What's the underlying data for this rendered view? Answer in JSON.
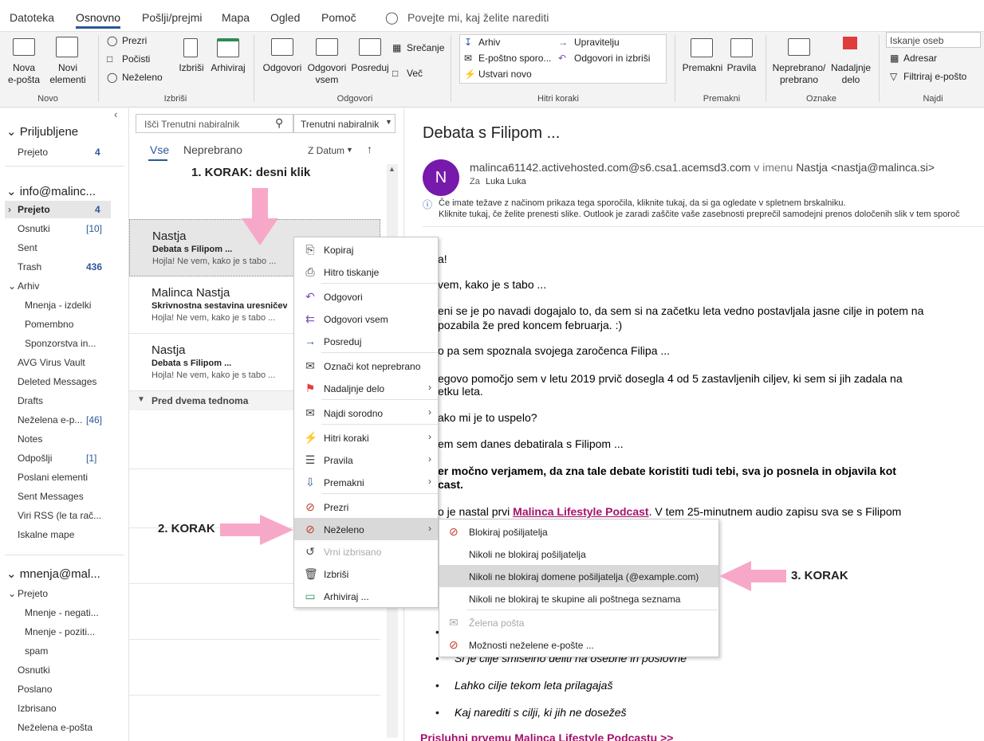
{
  "menubar": {
    "tabs": [
      "Datoteka",
      "Osnovno",
      "Pošlji/prejmi",
      "Mapa",
      "Ogled",
      "Pomoč"
    ],
    "tell_me": "Povejte mi, kaj želite narediti"
  },
  "ribbon": {
    "new_email": "Nova\ne-pošta",
    "new_items": "Novi\nelementi",
    "ignore": "Prezri",
    "cleanup": "Počisti",
    "junk": "Neželeno",
    "delete": "Izbriši",
    "archive": "Arhiviraj",
    "reply": "Odgovori",
    "reply_all": "Odgovori\nvsem",
    "forward": "Posreduj",
    "meeting": "Srečanje",
    "more": "Več",
    "qs_archive": "Arhiv",
    "qs_manager": "Upravitelju",
    "qs_email": "E-poštno sporo...",
    "qs_reply_delete": "Odgovori in izbriši",
    "qs_create": "Ustvari novo",
    "move": "Premakni",
    "rules": "Pravila",
    "unread": "Neprebrano/\nprebrano",
    "followup": "Nadaljnje\ndelo",
    "search_people": "Iskanje oseb",
    "address_book": "Adresar",
    "filter": "Filtriraj e-pošto",
    "groups": [
      "Novo",
      "Izbriši",
      "Odgovori",
      "Hitri koraki",
      "Premakni",
      "Oznake",
      "Najdi"
    ]
  },
  "nav": {
    "favorites": "Priljubljene",
    "fav_inbox": "Prejeto",
    "fav_inbox_count": "4",
    "account1": "info@malinc...",
    "items1": [
      {
        "label": "Prejeto",
        "count": "4"
      },
      {
        "label": "Osnutki",
        "count": "[10]"
      },
      {
        "label": "Sent",
        "count": ""
      },
      {
        "label": "Trash",
        "count": "436"
      },
      {
        "label": "Arhiv",
        "count": ""
      },
      {
        "label": "Mnenja  - izdelki",
        "count": ""
      },
      {
        "label": "Pomembno",
        "count": ""
      },
      {
        "label": "Sponzorstva in...",
        "count": ""
      },
      {
        "label": "AVG Virus Vault",
        "count": ""
      },
      {
        "label": "Deleted Messages",
        "count": ""
      },
      {
        "label": "Drafts",
        "count": ""
      },
      {
        "label": "Neželena e-p...",
        "count": "[46]"
      },
      {
        "label": "Notes",
        "count": ""
      },
      {
        "label": "Odpošlji",
        "count": "[1]"
      },
      {
        "label": "Poslani elementi",
        "count": ""
      },
      {
        "label": "Sent Messages",
        "count": ""
      },
      {
        "label": "Viri RSS (le ta rač...",
        "count": ""
      },
      {
        "label": "Iskalne mape",
        "count": ""
      }
    ],
    "account2": "mnenja@mal...",
    "items2": [
      "Prejeto",
      "Mnenje - negati...",
      "Mnenje - poziti...",
      "spam",
      "Osnutki",
      "Poslano",
      "Izbrisano",
      "Neželena e-pošta"
    ]
  },
  "list": {
    "search_placeholder": "Išči Trenutni nabiralnik",
    "scope": "Trenutni nabiralnik",
    "tab_all": "Vse",
    "tab_unread": "Neprebrano",
    "sort": "Z Datum",
    "group": "Pred dvema tednoma",
    "items": [
      {
        "sender": "Nastja",
        "subject": "Debata s Filipom ...",
        "preview": "Hojla!  Ne vem, kako je s tabo ..."
      },
      {
        "sender": "Malinca Nastja",
        "subject": "Skrivnostna sestavina uresničevanj...",
        "preview": "Hojla!  Ne vem, kako je s tabo ..."
      },
      {
        "sender": "Nastja",
        "subject": "Debata s Filipom ...",
        "preview": "Hojla!  Ne vem, kako je s tabo ..."
      }
    ]
  },
  "read": {
    "title": "Debata s Filipom ...",
    "avatar": "N",
    "from": "malinca61142.activehosted.com@s6.csa1.acemsd3.com",
    "on_behalf": "v imenu",
    "from_name": "Nastja <nastja@malinca.si>",
    "to_label": "Za",
    "to": "Luka Luka",
    "info1": "Če imate težave z načinom prikaza tega sporočila, kliknite tukaj, da si ga ogledate v spletnem brskalniku.",
    "info2": "Kliknite tukaj, če želite prenesti slike. Outlook je zaradi zaščite vaše zasebnosti preprečil samodejni prenos določenih slik v tem sporoč",
    "body": [
      "a!",
      "vem, kako je s tabo ...",
      "eni se je po navadi dogajalo to, da sem si na začetku leta vedno postavljala jasne cilje in potem na",
      "pozabila že pred koncem februarja. :)",
      "o pa sem spoznala svojega zaročenca Filipa ...",
      "egovo pomočjo sem v letu 2019 prvič dosegla 4 od 5 zastavljenih ciljev, ki sem si jih zadala na",
      "etku leta.",
      "ako mi je to uspelo?",
      "em sem danes debatirala s Filipom ...",
      "er močno verjamem, da zna tale debate koristiti tudi tebi, sva jo posnela in objavila kot",
      "cast.",
      "o je nastal prvi ",
      "Malinca Lifestyle Podcast",
      ". V tem 25-minutnem audio zapisu sva se s Filipom"
    ],
    "bullets": [
      "Si je cilje smiselno deliti na osebne in poslovne",
      "Lahko cilje tekom leta prilagajaš",
      "Kaj narediti s cilji, ki jih ne dosežeš"
    ],
    "link_bottom": "Prisluhni prvemu Malinca Lifestyle Podcastu >>"
  },
  "context": [
    {
      "label": "Kopiraj",
      "icon": "copy-icon"
    },
    {
      "label": "Hitro tiskanje",
      "icon": "print-icon"
    },
    {
      "label": "Odgovori",
      "icon": "reply-icon"
    },
    {
      "label": "Odgovori vsem",
      "icon": "reply-all-icon"
    },
    {
      "label": "Posreduj",
      "icon": "forward-icon"
    },
    {
      "label": "Označi kot neprebrano",
      "icon": "envelope-icon"
    },
    {
      "label": "Nadaljnje delo",
      "icon": "flag-icon"
    },
    {
      "label": "Najdi sorodno",
      "icon": "find-icon"
    },
    {
      "label": "Hitri koraki",
      "icon": "bolt-icon"
    },
    {
      "label": "Pravila",
      "icon": "rules-icon"
    },
    {
      "label": "Premakni",
      "icon": "move-icon"
    },
    {
      "label": "Prezri",
      "icon": "ignore-icon"
    },
    {
      "label": "Neželeno",
      "icon": "junk-icon"
    },
    {
      "label": "Vrni izbrisano",
      "icon": "restore-icon"
    },
    {
      "label": "Izbriši",
      "icon": "trash-icon"
    },
    {
      "label": "Arhiviraj ...",
      "icon": "archive-icon"
    }
  ],
  "submenu": [
    "Blokiraj pošiljatelja",
    "Nikoli ne blokiraj pošiljatelja",
    "Nikoli ne blokiraj domene pošiljatelja (@example.com)",
    "Nikoli ne blokiraj te skupine ali poštnega seznama",
    "Želena pošta",
    "Možnosti neželene e-pošte ..."
  ],
  "steps": {
    "s1": "1. KORAK: desni klik",
    "s2": "2. KORAK",
    "s3": "3. KORAK"
  },
  "colors": {
    "accent": "#2b579a",
    "avatar": "#7719aa",
    "arrow": "#f7a8c8",
    "link": "#a4136b"
  }
}
